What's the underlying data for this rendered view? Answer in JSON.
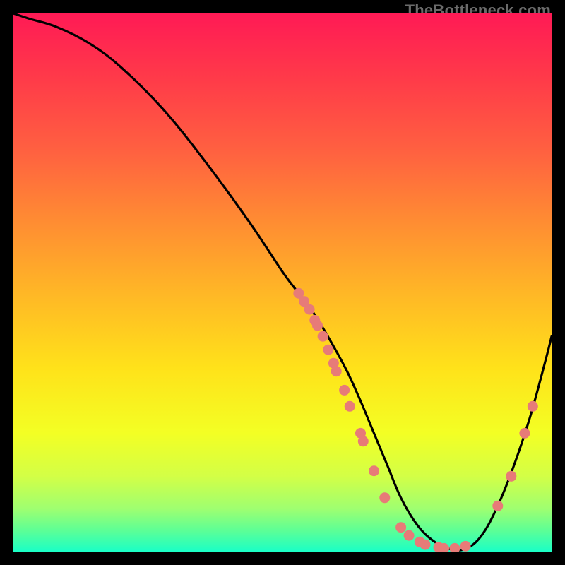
{
  "watermark": "TheBottleneck.com",
  "colors": {
    "bg": "#000000",
    "curve": "#000000",
    "dots": "#e77b78"
  },
  "chart_data": {
    "type": "line",
    "title": "",
    "xlabel": "",
    "ylabel": "",
    "xlim": [
      0,
      100
    ],
    "ylim": [
      0,
      100
    ],
    "grid": false,
    "series": [
      {
        "name": "bottleneck-curve",
        "x": [
          0,
          3,
          8,
          14,
          20,
          28,
          36,
          44,
          50,
          53,
          56,
          59,
          62,
          64.5,
          67,
          69.5,
          72,
          75,
          78,
          81,
          84,
          87,
          90,
          93,
          96,
          99,
          100
        ],
        "y": [
          100,
          99,
          97.5,
          94.5,
          90,
          82,
          72,
          61,
          52,
          48,
          44,
          39,
          33.5,
          28,
          22,
          16,
          10,
          5,
          2,
          0.5,
          0.5,
          3,
          8.5,
          16,
          25,
          36,
          40
        ]
      }
    ],
    "points": [
      {
        "x": 53,
        "y": 48
      },
      {
        "x": 54,
        "y": 46.5
      },
      {
        "x": 55,
        "y": 45
      },
      {
        "x": 56,
        "y": 43
      },
      {
        "x": 56.5,
        "y": 42
      },
      {
        "x": 57.5,
        "y": 40
      },
      {
        "x": 58.5,
        "y": 37.5
      },
      {
        "x": 59.5,
        "y": 35
      },
      {
        "x": 60,
        "y": 33.5
      },
      {
        "x": 61.5,
        "y": 30
      },
      {
        "x": 62.5,
        "y": 27
      },
      {
        "x": 64.5,
        "y": 22
      },
      {
        "x": 65,
        "y": 20.5
      },
      {
        "x": 67,
        "y": 15
      },
      {
        "x": 69,
        "y": 10
      },
      {
        "x": 72,
        "y": 4.5
      },
      {
        "x": 73.5,
        "y": 3
      },
      {
        "x": 75.5,
        "y": 1.8
      },
      {
        "x": 76.5,
        "y": 1.3
      },
      {
        "x": 79,
        "y": 0.8
      },
      {
        "x": 80,
        "y": 0.6
      },
      {
        "x": 82,
        "y": 0.6
      },
      {
        "x": 84,
        "y": 1
      },
      {
        "x": 90,
        "y": 8.5
      },
      {
        "x": 92.5,
        "y": 14
      },
      {
        "x": 95,
        "y": 22
      },
      {
        "x": 96.5,
        "y": 27
      }
    ]
  }
}
